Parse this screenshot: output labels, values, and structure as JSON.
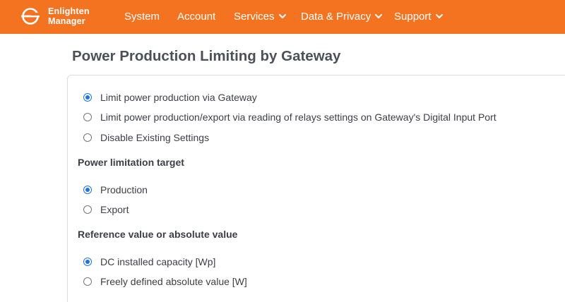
{
  "brand": {
    "line1": "Enlighten",
    "line2": "Manager"
  },
  "nav": {
    "system": "System",
    "account": "Account",
    "services": "Services",
    "data_privacy": "Data & Privacy",
    "support": "Support"
  },
  "colors": {
    "brand": "#f37321",
    "radio_accent": "#1a73e8"
  },
  "page_title": "Power Production Limiting by Gateway",
  "limiting_mode": {
    "options": [
      {
        "label": "Limit power production via Gateway",
        "checked": true
      },
      {
        "label": "Limit power production/export via reading of relays settings on Gateway's Digital Input Port",
        "checked": false
      },
      {
        "label": "Disable Existing Settings",
        "checked": false
      }
    ]
  },
  "power_limitation_target": {
    "heading": "Power limitation target",
    "options": [
      {
        "label": "Production",
        "checked": true
      },
      {
        "label": "Export",
        "checked": false
      }
    ]
  },
  "reference_value": {
    "heading": "Reference value or absolute value",
    "options": [
      {
        "label": "DC installed capacity [Wp]",
        "checked": true
      },
      {
        "label": "Freely defined absolute value [W]",
        "checked": false
      }
    ]
  }
}
